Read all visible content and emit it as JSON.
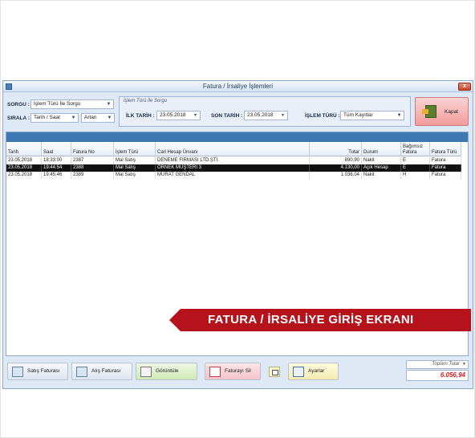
{
  "window": {
    "title": "Fatura / İrsaliye İşlemleri",
    "close_label": "x"
  },
  "filters": {
    "sorgu_label": "SORGU :",
    "sorgu_value": "İşlem Türü İle Sorgu",
    "sirala_label": "SIRALA :",
    "sirala_value": "Tarih / Saat",
    "sirala_order": "Artan",
    "group_caption": "İşlem Türü İle Sorgu",
    "ilk_tarih_label": "İLK TARİH :",
    "ilk_tarih_value": "23.05.2018",
    "son_tarih_label": "SON TARİH :",
    "son_tarih_value": "23.05.2018",
    "islem_turu_label": "İŞLEM TÜRÜ :",
    "islem_turu_value": "Tüm Kayıtlar"
  },
  "kapat_label": "Kapat",
  "table": {
    "columns": [
      "Tarih",
      "Saat",
      "Fatura No",
      "İşlem Türü",
      "Cari Hesap Ünvanı",
      "Tutar",
      "Durum",
      "Bağımsız Fatura",
      "Fatura Türü"
    ],
    "rows": [
      [
        "23.05.2018",
        "18:33:00",
        "2387",
        "Mal Satış",
        "DENEME FİRMASI LTD.ŞTİ.",
        "890,90",
        "Nakit",
        "E",
        "Fatura"
      ],
      [
        "23.05.2018",
        "19:44:54",
        "2388",
        "Mal Satış",
        "ÖRNEK MÜŞTERİ 3",
        "4.130,00",
        "Açık Hesap",
        "E",
        "Fatura"
      ],
      [
        "23.05.2018",
        "19:45:46",
        "2389",
        "Mal Satış",
        "MURAT GENDAL",
        "1.036,04",
        "Nakit",
        "H",
        "Fatura"
      ]
    ],
    "selected_row": 1
  },
  "banner_text": "FATURA / İRSALİYE GİRİŞ EKRANI",
  "buttons": {
    "satis": "Satış Faturası",
    "alis": "Alış Faturası",
    "goruntule": "Görüntüle",
    "sil": "Faturayı Sil",
    "ayarlar": "Ayarlar"
  },
  "total": {
    "label": "Toplam Tutar",
    "value": "6.056,94"
  },
  "colors": {
    "accent": "#3e78b2",
    "banner": "#b5121b",
    "total": "#d42020"
  }
}
